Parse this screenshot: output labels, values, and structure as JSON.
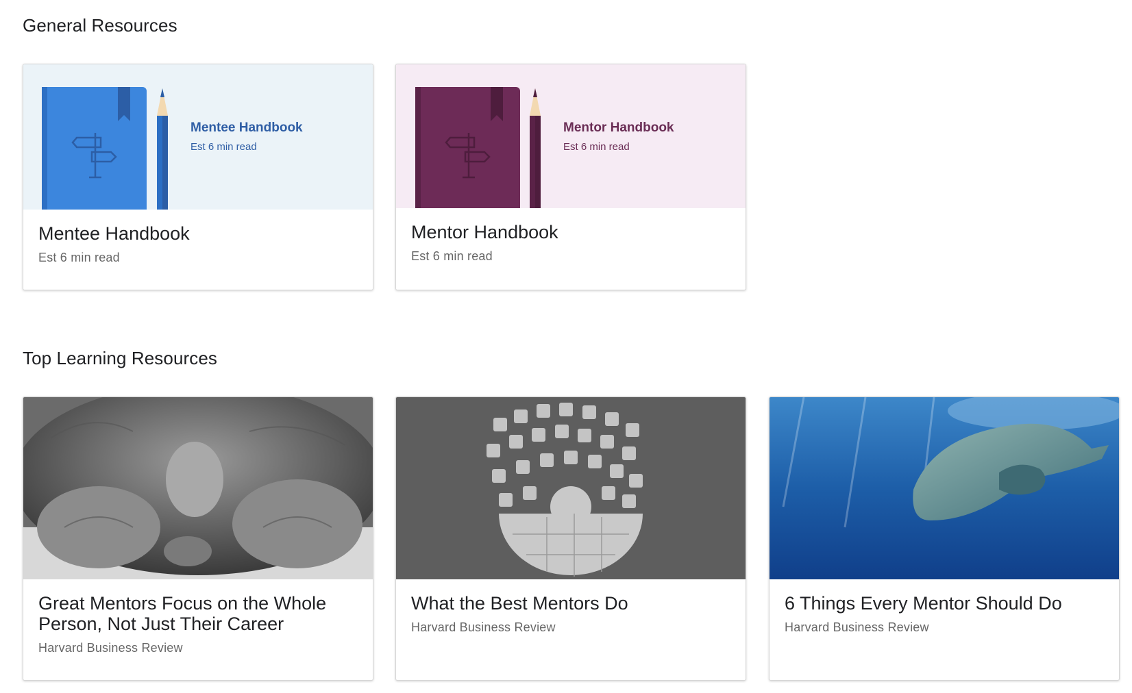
{
  "sections": [
    {
      "title": "General Resources",
      "cards": [
        {
          "thumb_title": "Mentee Handbook",
          "thumb_sub": "Est 6 min read",
          "title": "Mentee Handbook",
          "subtitle": "Est 6 min read",
          "theme": {
            "bg": "#ebf3f8",
            "book": "#3c86dd",
            "accent": "#2c5ea6",
            "text": "#2f5ea5"
          }
        },
        {
          "thumb_title": "Mentor Handbook",
          "thumb_sub": "Est 6 min read",
          "title": "Mentor Handbook",
          "subtitle": "Est 6 min read",
          "theme": {
            "bg": "#f6ebf4",
            "book": "#6d2b57",
            "accent": "#4e1d3d",
            "text": "#6a2d55"
          }
        }
      ]
    },
    {
      "title": "Top Learning Resources",
      "cards": [
        {
          "title": "Great Mentors Focus on the Whole Person, Not Just Their Career",
          "subtitle": "Harvard Business Review",
          "image": "tortoise-photo"
        },
        {
          "title": "What the Best Mentors Do",
          "subtitle": "Harvard Business Review",
          "image": "puzzle-pieces-photo"
        },
        {
          "title": "6 Things Every Mentor Should Do",
          "subtitle": "Harvard Business Review",
          "image": "whale-photo"
        }
      ]
    }
  ]
}
